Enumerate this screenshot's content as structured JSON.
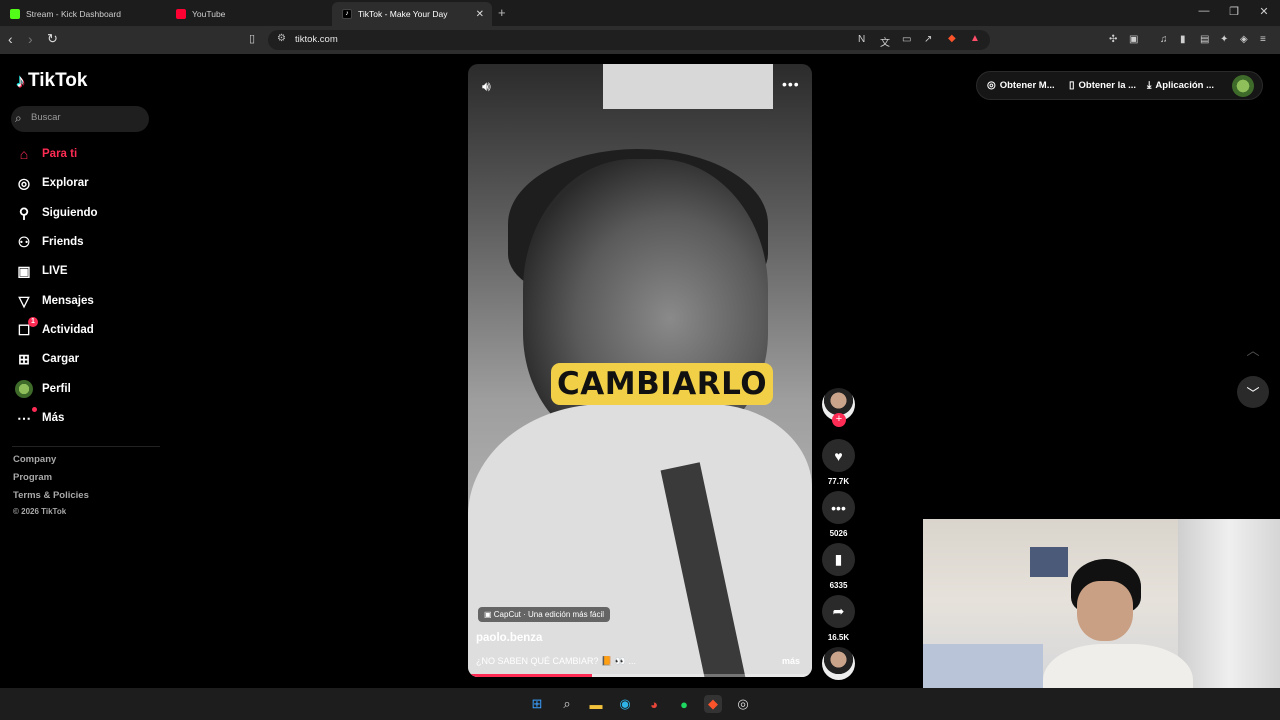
{
  "browser": {
    "tabs": [
      {
        "title": "Stream - Kick Dashboard",
        "color": "#53fc18"
      },
      {
        "title": "YouTube",
        "color": "#ff0033"
      },
      {
        "title": "TikTok - Make Your Day",
        "color": "#ffffff"
      }
    ],
    "url": "tiktok.com"
  },
  "sidebar": {
    "logo": "TikTok",
    "search_placeholder": "Buscar",
    "items": [
      {
        "label": "Para ti",
        "icon": "home-icon"
      },
      {
        "label": "Explorar",
        "icon": "compass-icon"
      },
      {
        "label": "Siguiendo",
        "icon": "following-icon"
      },
      {
        "label": "Friends",
        "icon": "friends-icon"
      },
      {
        "label": "LIVE",
        "icon": "live-icon"
      },
      {
        "label": "Mensajes",
        "icon": "messages-icon"
      },
      {
        "label": "Actividad",
        "icon": "activity-icon",
        "badge": "1"
      },
      {
        "label": "Cargar",
        "icon": "upload-icon"
      },
      {
        "label": "Perfil",
        "icon": "profile-icon"
      },
      {
        "label": "Más",
        "icon": "more-icon"
      }
    ],
    "footer": [
      "Company",
      "Program",
      "Terms & Policies"
    ],
    "copyright": "© 2026 TikTok"
  },
  "video": {
    "caption_overlay": "CAMBIARLO",
    "capcut_label": "CapCut · Una edición más fácil",
    "author": "paolo.benza",
    "description": "¿NO SABEN QUÉ CAMBIAR? 📙 👀 ...",
    "more_label": "más",
    "progress": 0.36
  },
  "actions": {
    "likes": "77.7K",
    "comments": "5026",
    "saves": "6335",
    "shares": "16.5K"
  },
  "topbar": {
    "btn1": "Obtener M...",
    "btn2": "Obtener la ...",
    "btn3": "Aplicación ..."
  },
  "colors": {
    "accent": "#fe2c55",
    "caption_bg": "#f1d048"
  }
}
